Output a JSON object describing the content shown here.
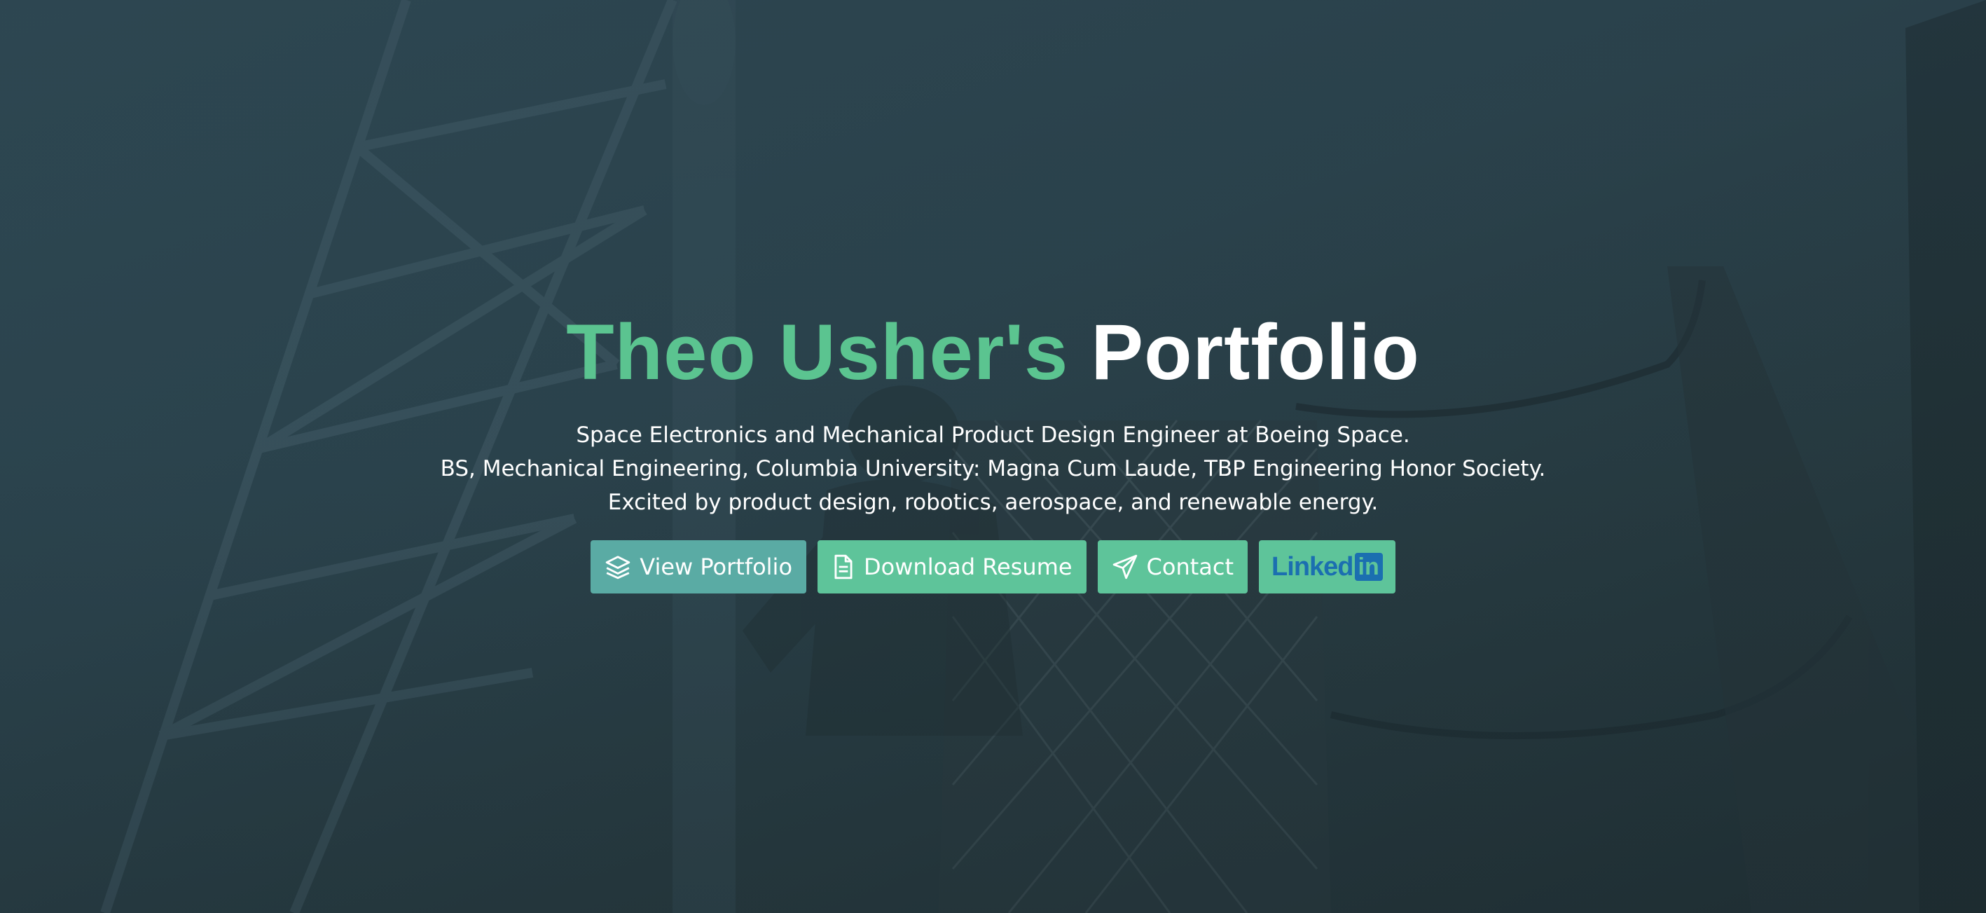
{
  "hero": {
    "title_name": "Theo Usher's",
    "title_rest": "Portfolio",
    "subtitle_lines": [
      "Space Electronics and Mechanical Product Design Engineer at Boeing Space.",
      "BS, Mechanical Engineering, Columbia University: Magna Cum Laude, TBP Engineering Honor Society.",
      "Excited by product design, robotics, aerospace, and renewable energy."
    ]
  },
  "buttons": {
    "portfolio": {
      "label": "View Portfolio",
      "icon": "layers-icon"
    },
    "resume": {
      "label": "Download Resume",
      "icon": "document-icon"
    },
    "contact": {
      "label": "Contact",
      "icon": "paper-plane-icon"
    },
    "linkedin": {
      "label_text": "Linked",
      "label_box": "in",
      "icon": "linkedin-logo"
    }
  },
  "colors": {
    "accent_green": "#5bc490",
    "button_teal": "#5aaba4",
    "button_green": "#5ec49a",
    "linkedin_blue": "#1b6fb0",
    "background": "#2b434d"
  }
}
